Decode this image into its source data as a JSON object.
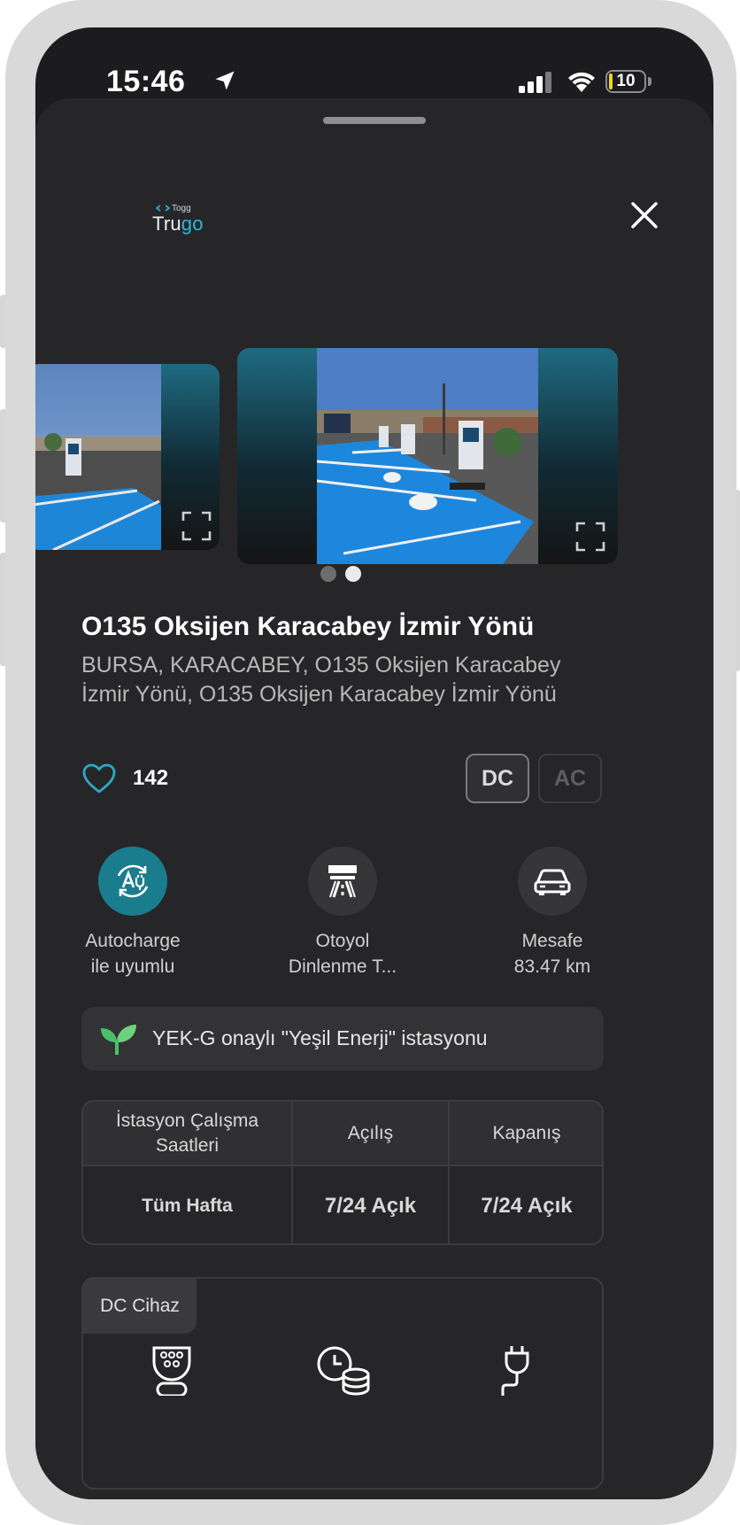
{
  "status_bar": {
    "time": "15:46",
    "battery": "10",
    "battery_level_percent": 10
  },
  "header": {
    "logo_small": "Togg",
    "logo_main_a": "Tru",
    "logo_main_b": "go"
  },
  "gallery": {
    "page_count": 2,
    "active_page": 2
  },
  "station": {
    "title": "O135 Oksijen Karacabey İzmir Yönü",
    "address": "BURSA, KARACABEY, O135 Oksijen Karacabey İzmir Yönü, O135 Oksijen Karacabey İzmir Yönü",
    "likes": "142"
  },
  "chips": {
    "dc": "DC",
    "ac": "AC",
    "selected": "DC"
  },
  "features": [
    {
      "line1": "Autocharge",
      "line2": "ile uyumlu",
      "icon": "autocharge-icon"
    },
    {
      "line1": "Otoyol",
      "line2": "Dinlenme T...",
      "icon": "highway-icon"
    },
    {
      "line1": "Mesafe",
      "line2": "83.47 km",
      "icon": "car-icon"
    }
  ],
  "green_banner": {
    "text": "YEK-G onaylı \"Yeşil Enerji\" istasyonu",
    "icon": "leaf-icon"
  },
  "hours_table": {
    "headers": [
      "İstasyon Çalışma Saatleri",
      "Açılış",
      "Kapanış"
    ],
    "rows": [
      [
        "Tüm Hafta",
        "7/24 Açık",
        "7/24 Açık"
      ]
    ]
  },
  "device_section": {
    "tab": "DC Cihaz",
    "icons": [
      "connector-icon",
      "clock-coins-icon",
      "plug-icon"
    ]
  },
  "colors": {
    "sheet_bg": "#262628",
    "accent_teal": "#1a7d8e",
    "heart": "#2fa7c7",
    "leaf": "#4bc06a"
  }
}
